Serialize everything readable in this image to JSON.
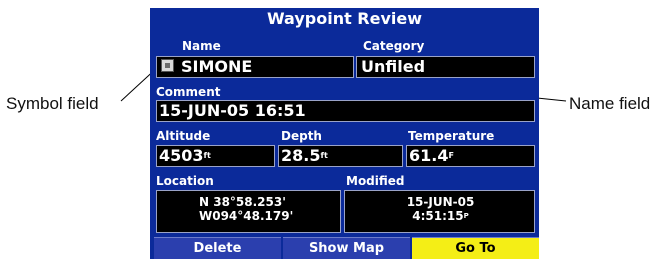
{
  "callouts": {
    "symbol_field": "Symbol field",
    "name_field": "Name field"
  },
  "screen": {
    "title": "Waypoint Review",
    "name": {
      "label": "Name",
      "value": "SIMONE",
      "symbol_icon": "waypoint-symbol-icon"
    },
    "category": {
      "label": "Category",
      "value": "Unfiled"
    },
    "comment": {
      "label": "Comment",
      "value": "15-JUN-05 16:51"
    },
    "altitude": {
      "label": "Altitude",
      "value": "4503",
      "unit": "ft"
    },
    "depth": {
      "label": "Depth",
      "value": "28.5",
      "unit": "ft"
    },
    "temperature": {
      "label": "Temperature",
      "value": "61.4",
      "unit": "F"
    },
    "location": {
      "label": "Location",
      "line1": "N  38°58.253'",
      "line2": "W094°48.179'"
    },
    "modified": {
      "label": "Modified",
      "line1": "15-JUN-05",
      "line2": "4:51:15",
      "suffix": "P"
    },
    "buttons": {
      "delete": "Delete",
      "show_map": "Show Map",
      "go_to": "Go To"
    }
  },
  "colors": {
    "screen_bg": "#0b2a9a",
    "active_button": "#f4ee16"
  }
}
